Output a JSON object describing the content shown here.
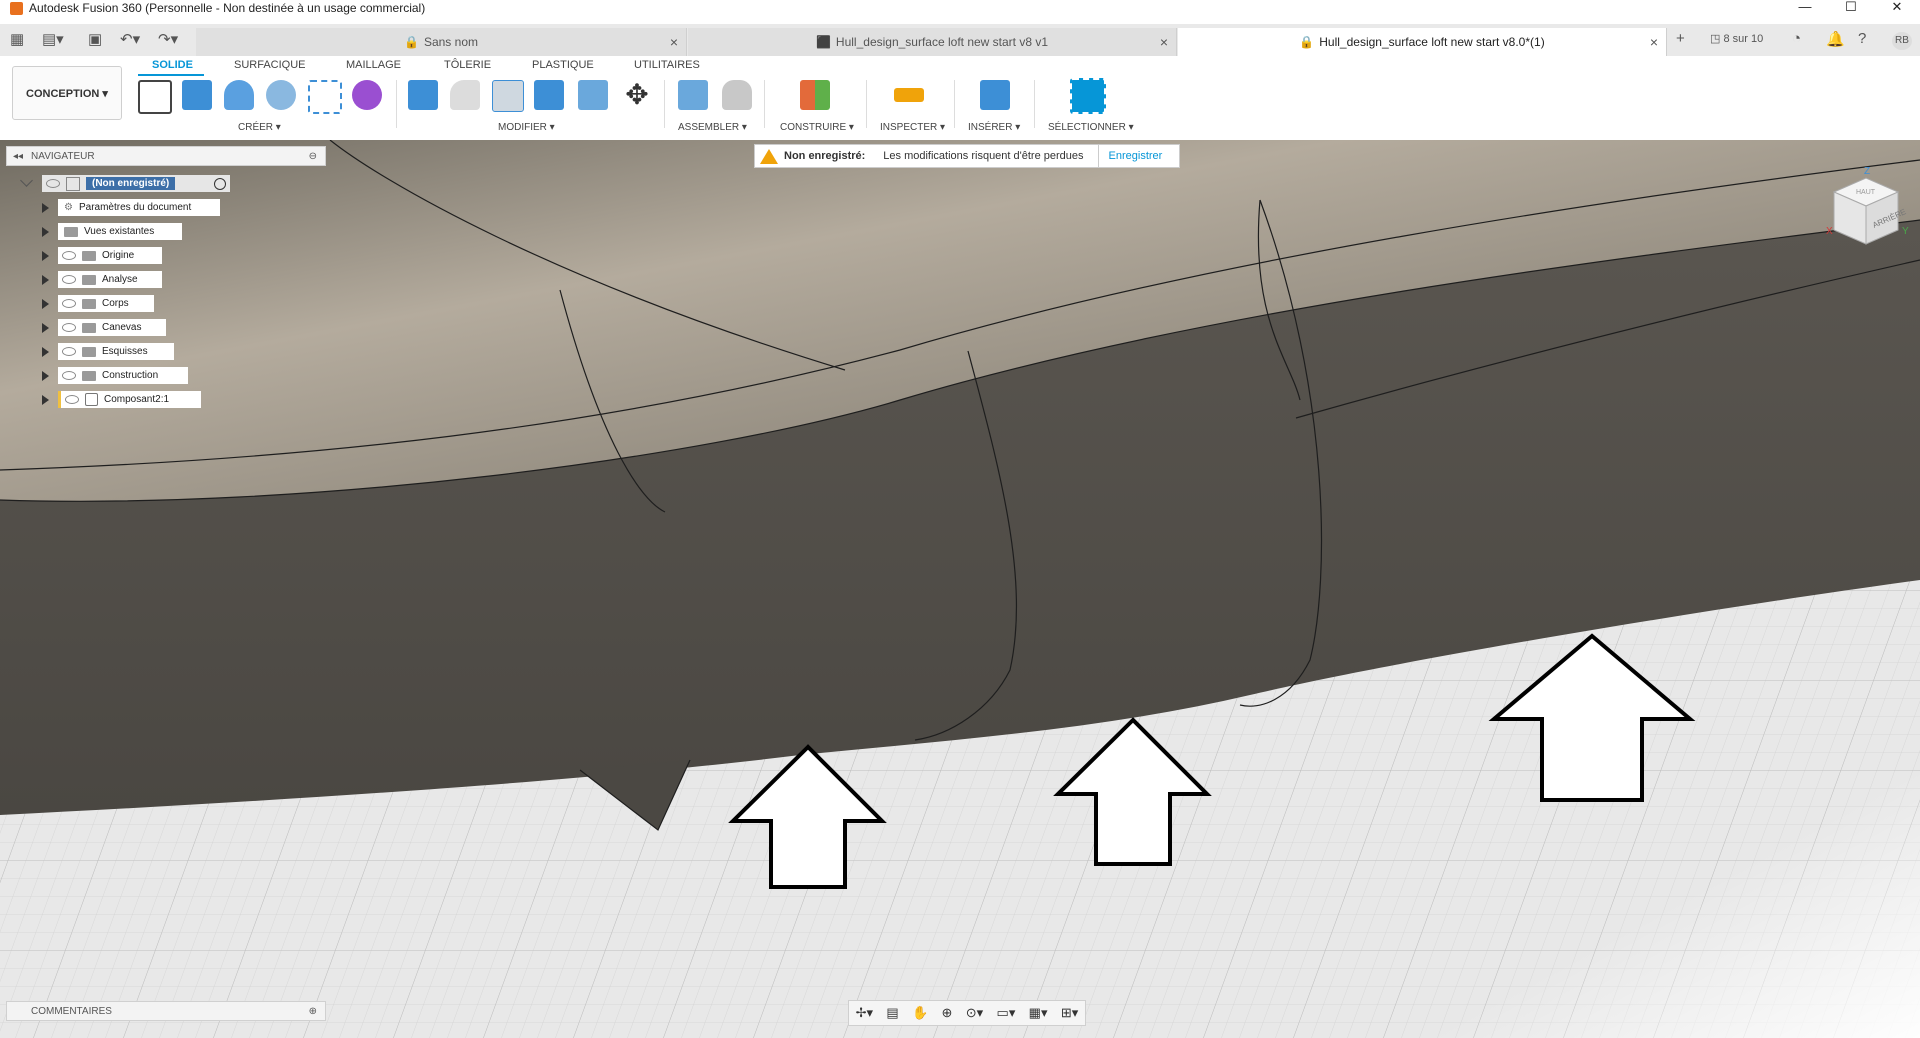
{
  "window": {
    "title": "Autodesk Fusion 360 (Personnelle - Non destinée à un usage commercial)",
    "minimize": "—",
    "maximize": "☐",
    "close": "✕"
  },
  "tabs": [
    {
      "label": "Sans nom",
      "active": false
    },
    {
      "label": "Hull_design_surface loft new start v8 v1",
      "active": false
    },
    {
      "label": "Hull_design_surface loft new start v8.0*(1)",
      "active": true
    }
  ],
  "tabbar_right": {
    "new_tab": "+",
    "job_count": "8 sur 10",
    "user_initials": "RB"
  },
  "workspace": {
    "selector": "CONCEPTION ▾",
    "tabs": [
      "SOLIDE",
      "SURFACIQUE",
      "MAILLAGE",
      "TÔLERIE",
      "PLASTIQUE",
      "UTILITAIRES"
    ]
  },
  "toolbar_groups": [
    "CRÉER ▾",
    "MODIFIER ▾",
    "ASSEMBLER ▾",
    "CONSTRUIRE ▾",
    "INSPECTER ▾",
    "INSÉRER ▾",
    "SÉLECTIONNER ▾"
  ],
  "warning": {
    "label": "Non enregistré:",
    "message": "Les modifications risquent d'être perdues",
    "save": "Enregistrer"
  },
  "navigator": {
    "title": "NAVIGATEUR",
    "root": "(Non enregistré)",
    "items": [
      "Paramètres du document",
      "Vues existantes",
      "Origine",
      "Analyse",
      "Corps",
      "Canevas",
      "Esquisses",
      "Construction",
      "Composant2:1"
    ]
  },
  "comments": {
    "title": "COMMENTAIRES"
  },
  "viewcube": {
    "face": "ARRIÈRE",
    "top_face": "HAUT",
    "axis_z": "Z",
    "axis_x": "X",
    "axis_y": "Y"
  },
  "colors": {
    "accent": "#0696d7",
    "warning": "#f0a30a",
    "surface_dark": "#55524c"
  }
}
